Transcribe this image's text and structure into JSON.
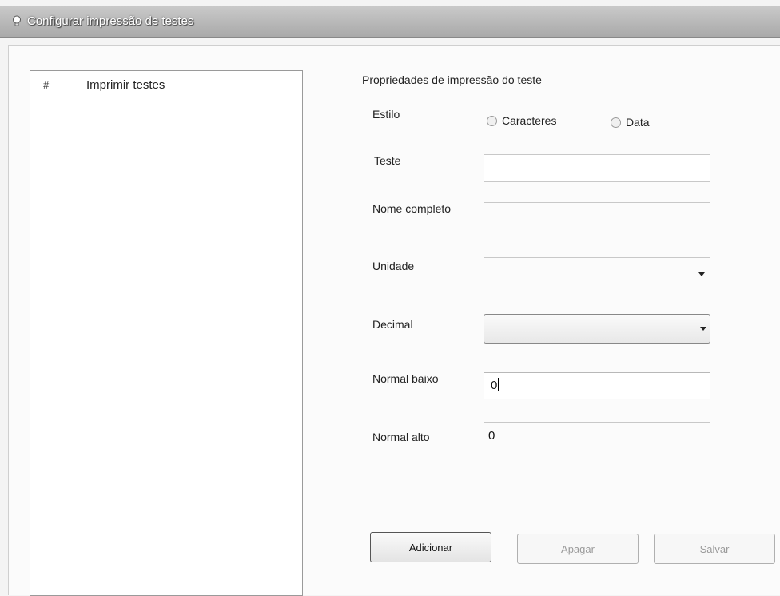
{
  "window": {
    "title": "Configurar impressão de testes",
    "icon": "lightbulb-icon"
  },
  "list": {
    "columns": [
      "#",
      "Imprimir testes"
    ]
  },
  "form": {
    "section_title": "Propriedades de impressão do teste",
    "estilo_label": "Estilo",
    "estilo_options": [
      "Caracteres",
      "Data"
    ],
    "teste_label": "Teste",
    "teste_value": "",
    "nome_completo_label": "Nome completo",
    "nome_completo_value": "",
    "unidade_label": "Unidade",
    "unidade_value": "",
    "decimal_label": "Decimal",
    "decimal_value": "",
    "normal_baixo_label": "Normal baixo",
    "normal_baixo_value": "0",
    "normal_alto_label": "Normal alto",
    "normal_alto_value": "0"
  },
  "buttons": {
    "adicionar": "Adicionar",
    "apagar": "Apagar",
    "salvar": "Salvar"
  }
}
